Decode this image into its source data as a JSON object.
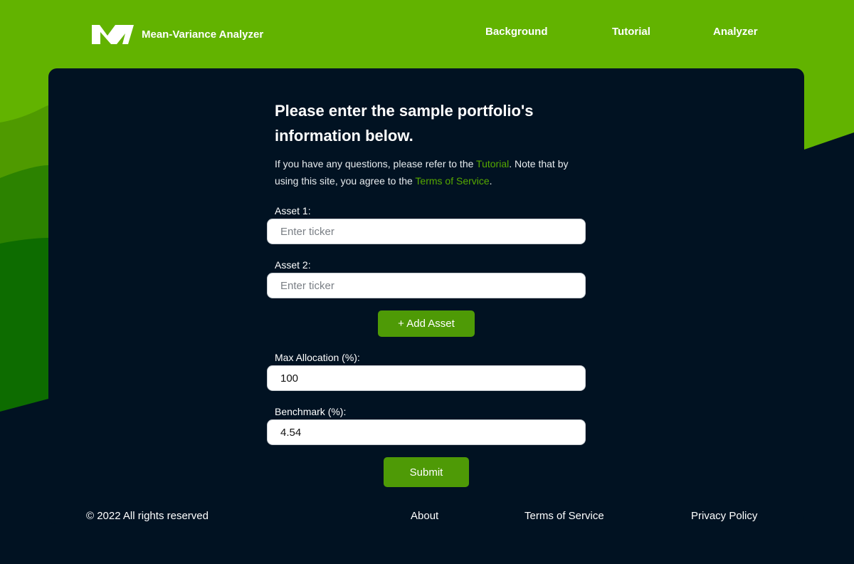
{
  "colors": {
    "brand_green": "#62b300",
    "accent_green": "#4e9a06",
    "link_green": "#56a800",
    "panel_background": "#011222"
  },
  "header": {
    "logo_icon": "mv-logo-icon",
    "app_name": "Mean-Variance Analyzer",
    "nav": {
      "background": "Background",
      "tutorial": "Tutorial",
      "analyzer": "Analyzer"
    }
  },
  "form": {
    "title": "Please enter the sample portfolio's information below.",
    "intro": {
      "part1": "If you have any questions, please refer to the ",
      "tutorial_link": "Tutorial",
      "part2": ". Note that by using this site, you agree to the ",
      "tos_link": "Terms of Service",
      "part3": "."
    },
    "asset1": {
      "label": "Asset 1:",
      "placeholder": "Enter ticker",
      "value": ""
    },
    "asset2": {
      "label": "Asset 2:",
      "placeholder": "Enter ticker",
      "value": ""
    },
    "add_asset_label": "+ Add Asset",
    "max_allocation": {
      "label": "Max Allocation (%):",
      "value": "100"
    },
    "benchmark": {
      "label": "Benchmark (%):",
      "value": "4.54"
    },
    "submit_label": "Submit"
  },
  "footer": {
    "copyright": "© 2022 All rights reserved",
    "about": "About",
    "terms": "Terms of Service",
    "privacy": "Privacy Policy"
  }
}
